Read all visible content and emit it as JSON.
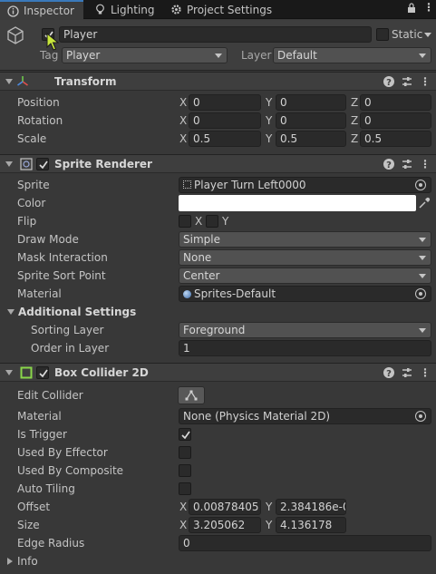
{
  "tabs": {
    "inspector": "Inspector",
    "lighting": "Lighting",
    "project_settings": "Project Settings"
  },
  "header": {
    "object_name": "Player",
    "static_label": "Static",
    "tag_label": "Tag",
    "tag_value": "Player",
    "layer_label": "Layer",
    "layer_value": "Default"
  },
  "transform": {
    "title": "Transform",
    "rows": [
      {
        "label": "Position",
        "x": "0",
        "y": "0",
        "z": "0"
      },
      {
        "label": "Rotation",
        "x": "0",
        "y": "0",
        "z": "0"
      },
      {
        "label": "Scale",
        "x": "0.5",
        "y": "0.5",
        "z": "0.5"
      }
    ]
  },
  "sprite_renderer": {
    "title": "Sprite Renderer",
    "sprite_label": "Sprite",
    "sprite_value": "Player Turn Left0000",
    "color_label": "Color",
    "color_value": "#ffffff",
    "flip_label": "Flip",
    "flip_x": "X",
    "flip_y": "Y",
    "draw_mode_label": "Draw Mode",
    "draw_mode_value": "Simple",
    "mask_label": "Mask Interaction",
    "mask_value": "None",
    "sort_point_label": "Sprite Sort Point",
    "sort_point_value": "Center",
    "material_label": "Material",
    "material_value": "Sprites-Default",
    "additional_settings": "Additional Settings",
    "sorting_layer_label": "Sorting Layer",
    "sorting_layer_value": "Foreground",
    "order_label": "Order in Layer",
    "order_value": "1"
  },
  "box_collider": {
    "title": "Box Collider 2D",
    "edit_collider_label": "Edit Collider",
    "material_label": "Material",
    "material_value": "None (Physics Material 2D)",
    "is_trigger_label": "Is Trigger",
    "is_trigger": true,
    "used_by_effector_label": "Used By Effector",
    "used_by_composite_label": "Used By Composite",
    "auto_tiling_label": "Auto Tiling",
    "offset_label": "Offset",
    "offset_x": "0.00878405",
    "offset_y": "2.384186e-0",
    "size_label": "Size",
    "size_x": "3.205062",
    "size_y": "4.136178",
    "edge_radius_label": "Edge Radius",
    "edge_radius_value": "0",
    "info_label": "Info"
  },
  "axis": {
    "x": "X",
    "y": "Y",
    "z": "Z"
  },
  "colors": {
    "accent": "#3a79bb",
    "background": "#383838",
    "field": "#2a2a2a"
  }
}
